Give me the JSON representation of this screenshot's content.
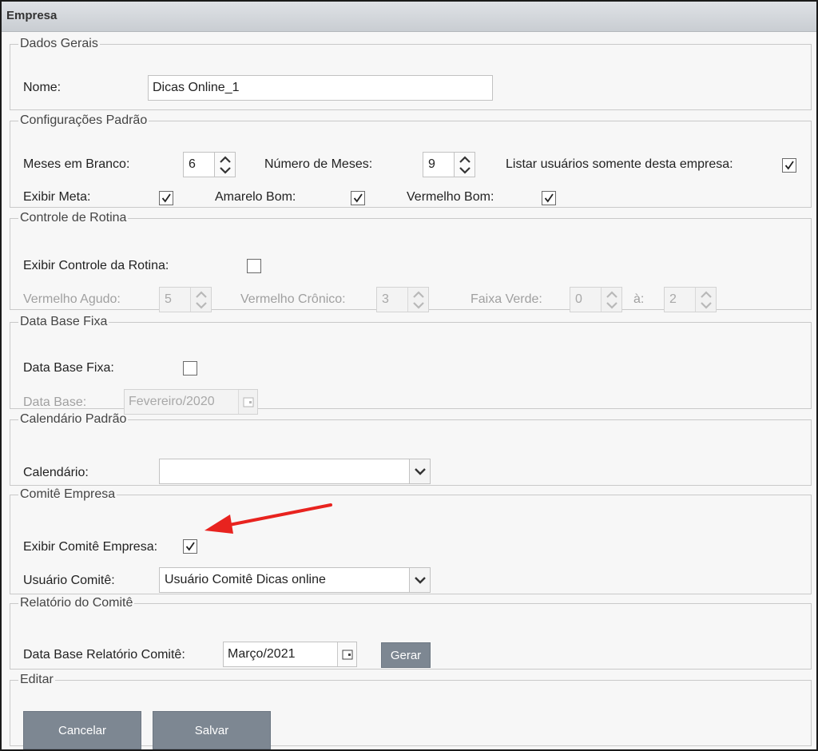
{
  "window": {
    "title": "Empresa"
  },
  "dados_gerais": {
    "legend": "Dados Gerais",
    "nome_label": "Nome:",
    "nome_value": "Dicas Online_1"
  },
  "config_padrao": {
    "legend": "Configurações Padrão",
    "meses_branco_label": "Meses em Branco:",
    "meses_branco_value": "6",
    "numero_meses_label": "Número de Meses:",
    "numero_meses_value": "9",
    "listar_usuarios_label": "Listar usuários somente desta empresa:",
    "listar_usuarios_checked": true,
    "exibir_meta_label": "Exibir Meta:",
    "exibir_meta_checked": true,
    "amarelo_bom_label": "Amarelo Bom:",
    "amarelo_bom_checked": true,
    "vermelho_bom_label": "Vermelho Bom:",
    "vermelho_bom_checked": true
  },
  "controle_rotina": {
    "legend": "Controle de Rotina",
    "exibir_label": "Exibir Controle da Rotina:",
    "exibir_checked": false,
    "vermelho_agudo_label": "Vermelho Agudo:",
    "vermelho_agudo_value": "5",
    "vermelho_cronico_label": "Vermelho Crônico:",
    "vermelho_cronico_value": "3",
    "faixa_verde_label": "Faixa Verde:",
    "faixa_verde_from": "0",
    "faixa_verde_to_label": "à:",
    "faixa_verde_to": "2"
  },
  "data_base_fixa": {
    "legend": "Data Base Fixa",
    "fixa_label": "Data Base Fixa:",
    "fixa_checked": false,
    "data_base_label": "Data Base:",
    "data_base_value": "Fevereiro/2020"
  },
  "calendario_padrao": {
    "legend": "Calendário Padrão",
    "calendario_label": "Calendário:",
    "calendario_value": ""
  },
  "comite_empresa": {
    "legend": "Comitê Empresa",
    "exibir_label": "Exibir Comitê Empresa:",
    "exibir_checked": true,
    "usuario_label": "Usuário Comitê:",
    "usuario_value": "Usuário Comitê Dicas online"
  },
  "relatorio_comite": {
    "legend": "Relatório do Comitê",
    "data_base_label": "Data Base Relatório Comitê:",
    "data_base_value": "Março/2021",
    "gerar_label": "Gerar"
  },
  "editar": {
    "legend": "Editar",
    "cancelar_label": "Cancelar",
    "salvar_label": "Salvar"
  },
  "colors": {
    "annotation_arrow": "#e8231f",
    "button_grey": "#7d8792"
  },
  "icons": [
    "spin-up-icon",
    "spin-down-icon",
    "checkmark-icon",
    "chevron-down-icon",
    "calendar-icon",
    "red-arrow"
  ]
}
